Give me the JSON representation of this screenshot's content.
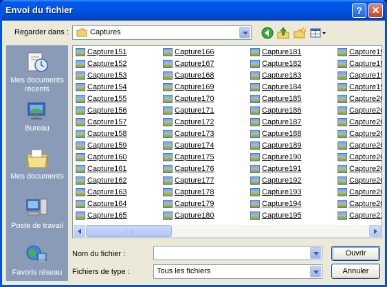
{
  "window": {
    "title": "Envoi du fichier"
  },
  "lookin": {
    "label": "Regarder dans :",
    "value": "Captures"
  },
  "toolbar": {
    "icons": [
      "back-icon",
      "up-folder-icon",
      "new-folder-icon",
      "views-menu-icon"
    ]
  },
  "places": [
    {
      "label": "Mes documents récents",
      "icon": "recent-documents-icon"
    },
    {
      "label": "Bureau",
      "icon": "desktop-icon"
    },
    {
      "label": "Mes documents",
      "icon": "my-documents-icon"
    },
    {
      "label": "Poste de travail",
      "icon": "my-computer-icon"
    },
    {
      "label": "Favoris réseau",
      "icon": "network-places-icon"
    }
  ],
  "files": {
    "col1": [
      "Capture151",
      "Capture152",
      "Capture153",
      "Capture154",
      "Capture155",
      "Capture156",
      "Capture157",
      "Capture158",
      "Capture159",
      "Capture160",
      "Capture161",
      "Capture162",
      "Capture163",
      "Capture164",
      "Capture165"
    ],
    "col2": [
      "Capture166",
      "Capture167",
      "Capture168",
      "Capture169",
      "Capture170",
      "Capture171",
      "Capture172",
      "Capture173",
      "Capture174",
      "Capture175",
      "Capture176",
      "Capture177",
      "Capture178",
      "Capture179",
      "Capture180"
    ],
    "col3": [
      "Capture181",
      "Capture182",
      "Capture183",
      "Capture184",
      "Capture185",
      "Capture186",
      "Capture187",
      "Capture188",
      "Capture189",
      "Capture190",
      "Capture191",
      "Capture192",
      "Capture193",
      "Capture194",
      "Capture195"
    ],
    "col4": [
      "Capture19",
      "Capture19",
      "Capture19",
      "Capture19",
      "Capture20",
      "Capture20",
      "Capture20",
      "Capture20",
      "Capture20",
      "Capture20",
      "Capture20",
      "Capture20",
      "Capture20",
      "Capture20",
      "Capture21"
    ]
  },
  "filename": {
    "label": "Nom du fichier :",
    "value": ""
  },
  "filetype": {
    "label": "Fichiers de type :",
    "value": "Tous les fichiers"
  },
  "buttons": {
    "open": "Ouvrir",
    "cancel": "Annuler"
  },
  "titlebar_buttons": {
    "help": "?",
    "close": "✕"
  }
}
